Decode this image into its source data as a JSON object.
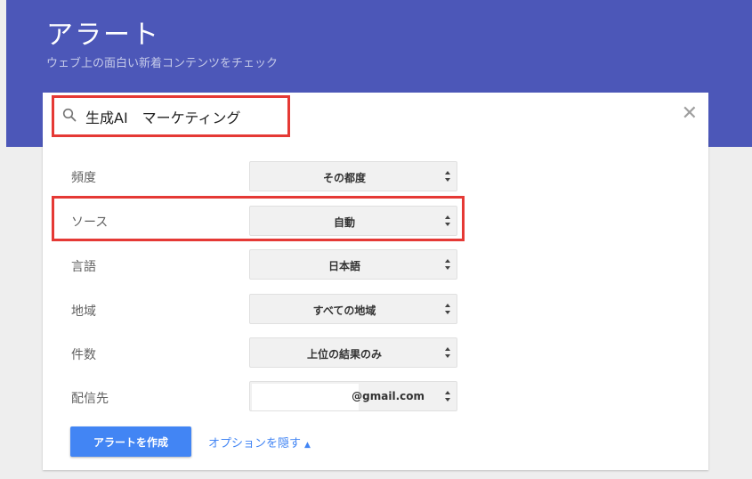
{
  "header": {
    "title": "アラート",
    "subtitle": "ウェブ上の面白い新着コンテンツをチェック"
  },
  "search": {
    "query": "生成AI　マーケティング",
    "clear_symbol": "✕"
  },
  "options": {
    "frequency": {
      "label": "頻度",
      "value": "その都度"
    },
    "source": {
      "label": "ソース",
      "value": "自動"
    },
    "language": {
      "label": "言語",
      "value": "日本語"
    },
    "region": {
      "label": "地域",
      "value": "すべての地域"
    },
    "count": {
      "label": "件数",
      "value": "上位の結果のみ"
    },
    "deliver_to": {
      "label": "配信先",
      "value": "@gmail.com"
    }
  },
  "actions": {
    "create_label": "アラートを作成",
    "hide_options_label": "オプションを隠す",
    "hide_options_arrow": "▲"
  },
  "colors": {
    "header_bg": "#4c57b8",
    "primary_button": "#4285f4",
    "highlight": "#e53935"
  }
}
